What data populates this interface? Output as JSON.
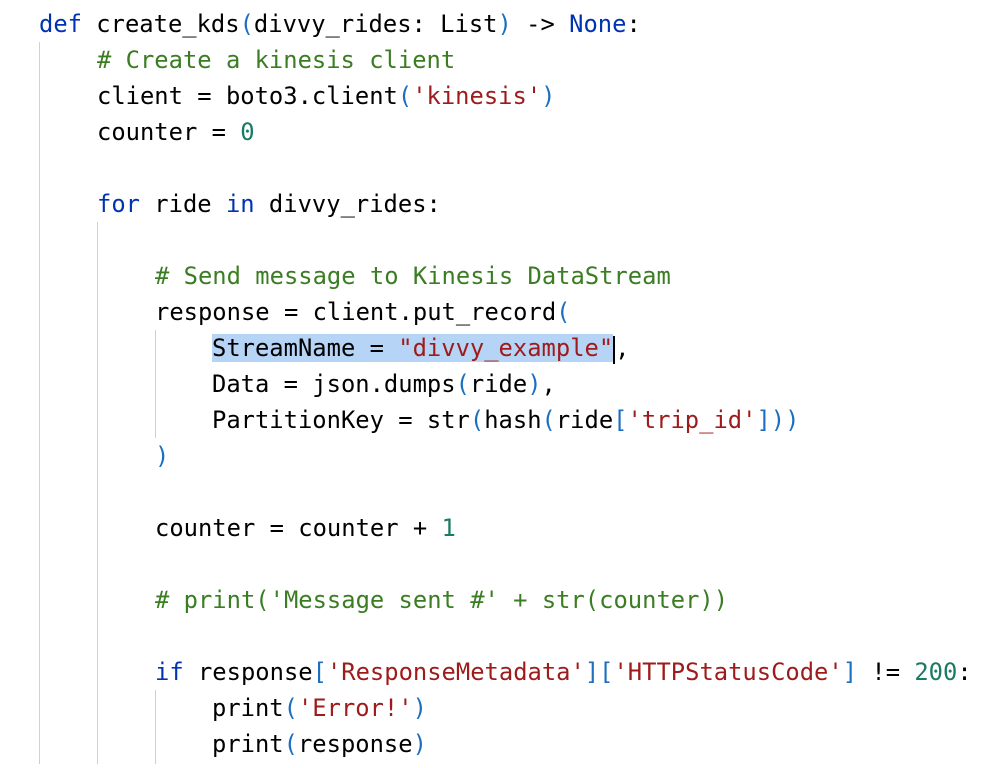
{
  "code": {
    "l1": {
      "def": "def",
      "fn": " create_kds",
      "p1": "(",
      "params": "divvy_rides: List",
      "p2": ")",
      "arrow": " -> ",
      "none": "None",
      "colon": ":"
    },
    "l2": {
      "comment": "# Create a kinesis client"
    },
    "l3": {
      "pre": "client = boto3.client",
      "p1": "(",
      "str": "'kinesis'",
      "p2": ")"
    },
    "l4": {
      "pre": "counter = ",
      "num": "0"
    },
    "l6": {
      "for": "for",
      "mid": " ride ",
      "in": "in",
      "post": " divvy_rides:"
    },
    "l8": {
      "comment": "# Send message to Kinesis DataStream"
    },
    "l9": {
      "pre": "response = client.put_record",
      "p1": "("
    },
    "l10": {
      "name": "StreamName",
      "eq": " = ",
      "str": "\"divvy_example\"",
      "post": ","
    },
    "l11": {
      "pre": "Data = json.dumps",
      "p1": "(",
      "mid": "ride",
      "p2": ")",
      "post": ","
    },
    "l12": {
      "pre": "PartitionKey = str",
      "p1": "(",
      "hash": "hash",
      "p2": "(",
      "ride": "ride",
      "p3": "[",
      "str": "'trip_id'",
      "p4": "]",
      "p5": ")",
      "p6": ")"
    },
    "l13": {
      "p1": ")"
    },
    "l15": {
      "pre": "counter = counter + ",
      "num": "1"
    },
    "l17": {
      "comment": "# print('Message sent #' + str(counter))"
    },
    "l19": {
      "if": "if",
      "pre": " response",
      "b1": "[",
      "s1": "'ResponseMetadata'",
      "b2": "]",
      "b3": "[",
      "s2": "'HTTPStatusCode'",
      "b4": "]",
      "op": " != ",
      "num": "200",
      "colon": ":"
    },
    "l20": {
      "pre": "print",
      "p1": "(",
      "str": "'Error!'",
      "p2": ")"
    },
    "l21": {
      "pre": "print",
      "p1": "(",
      "mid": "response",
      "p2": ")"
    }
  }
}
